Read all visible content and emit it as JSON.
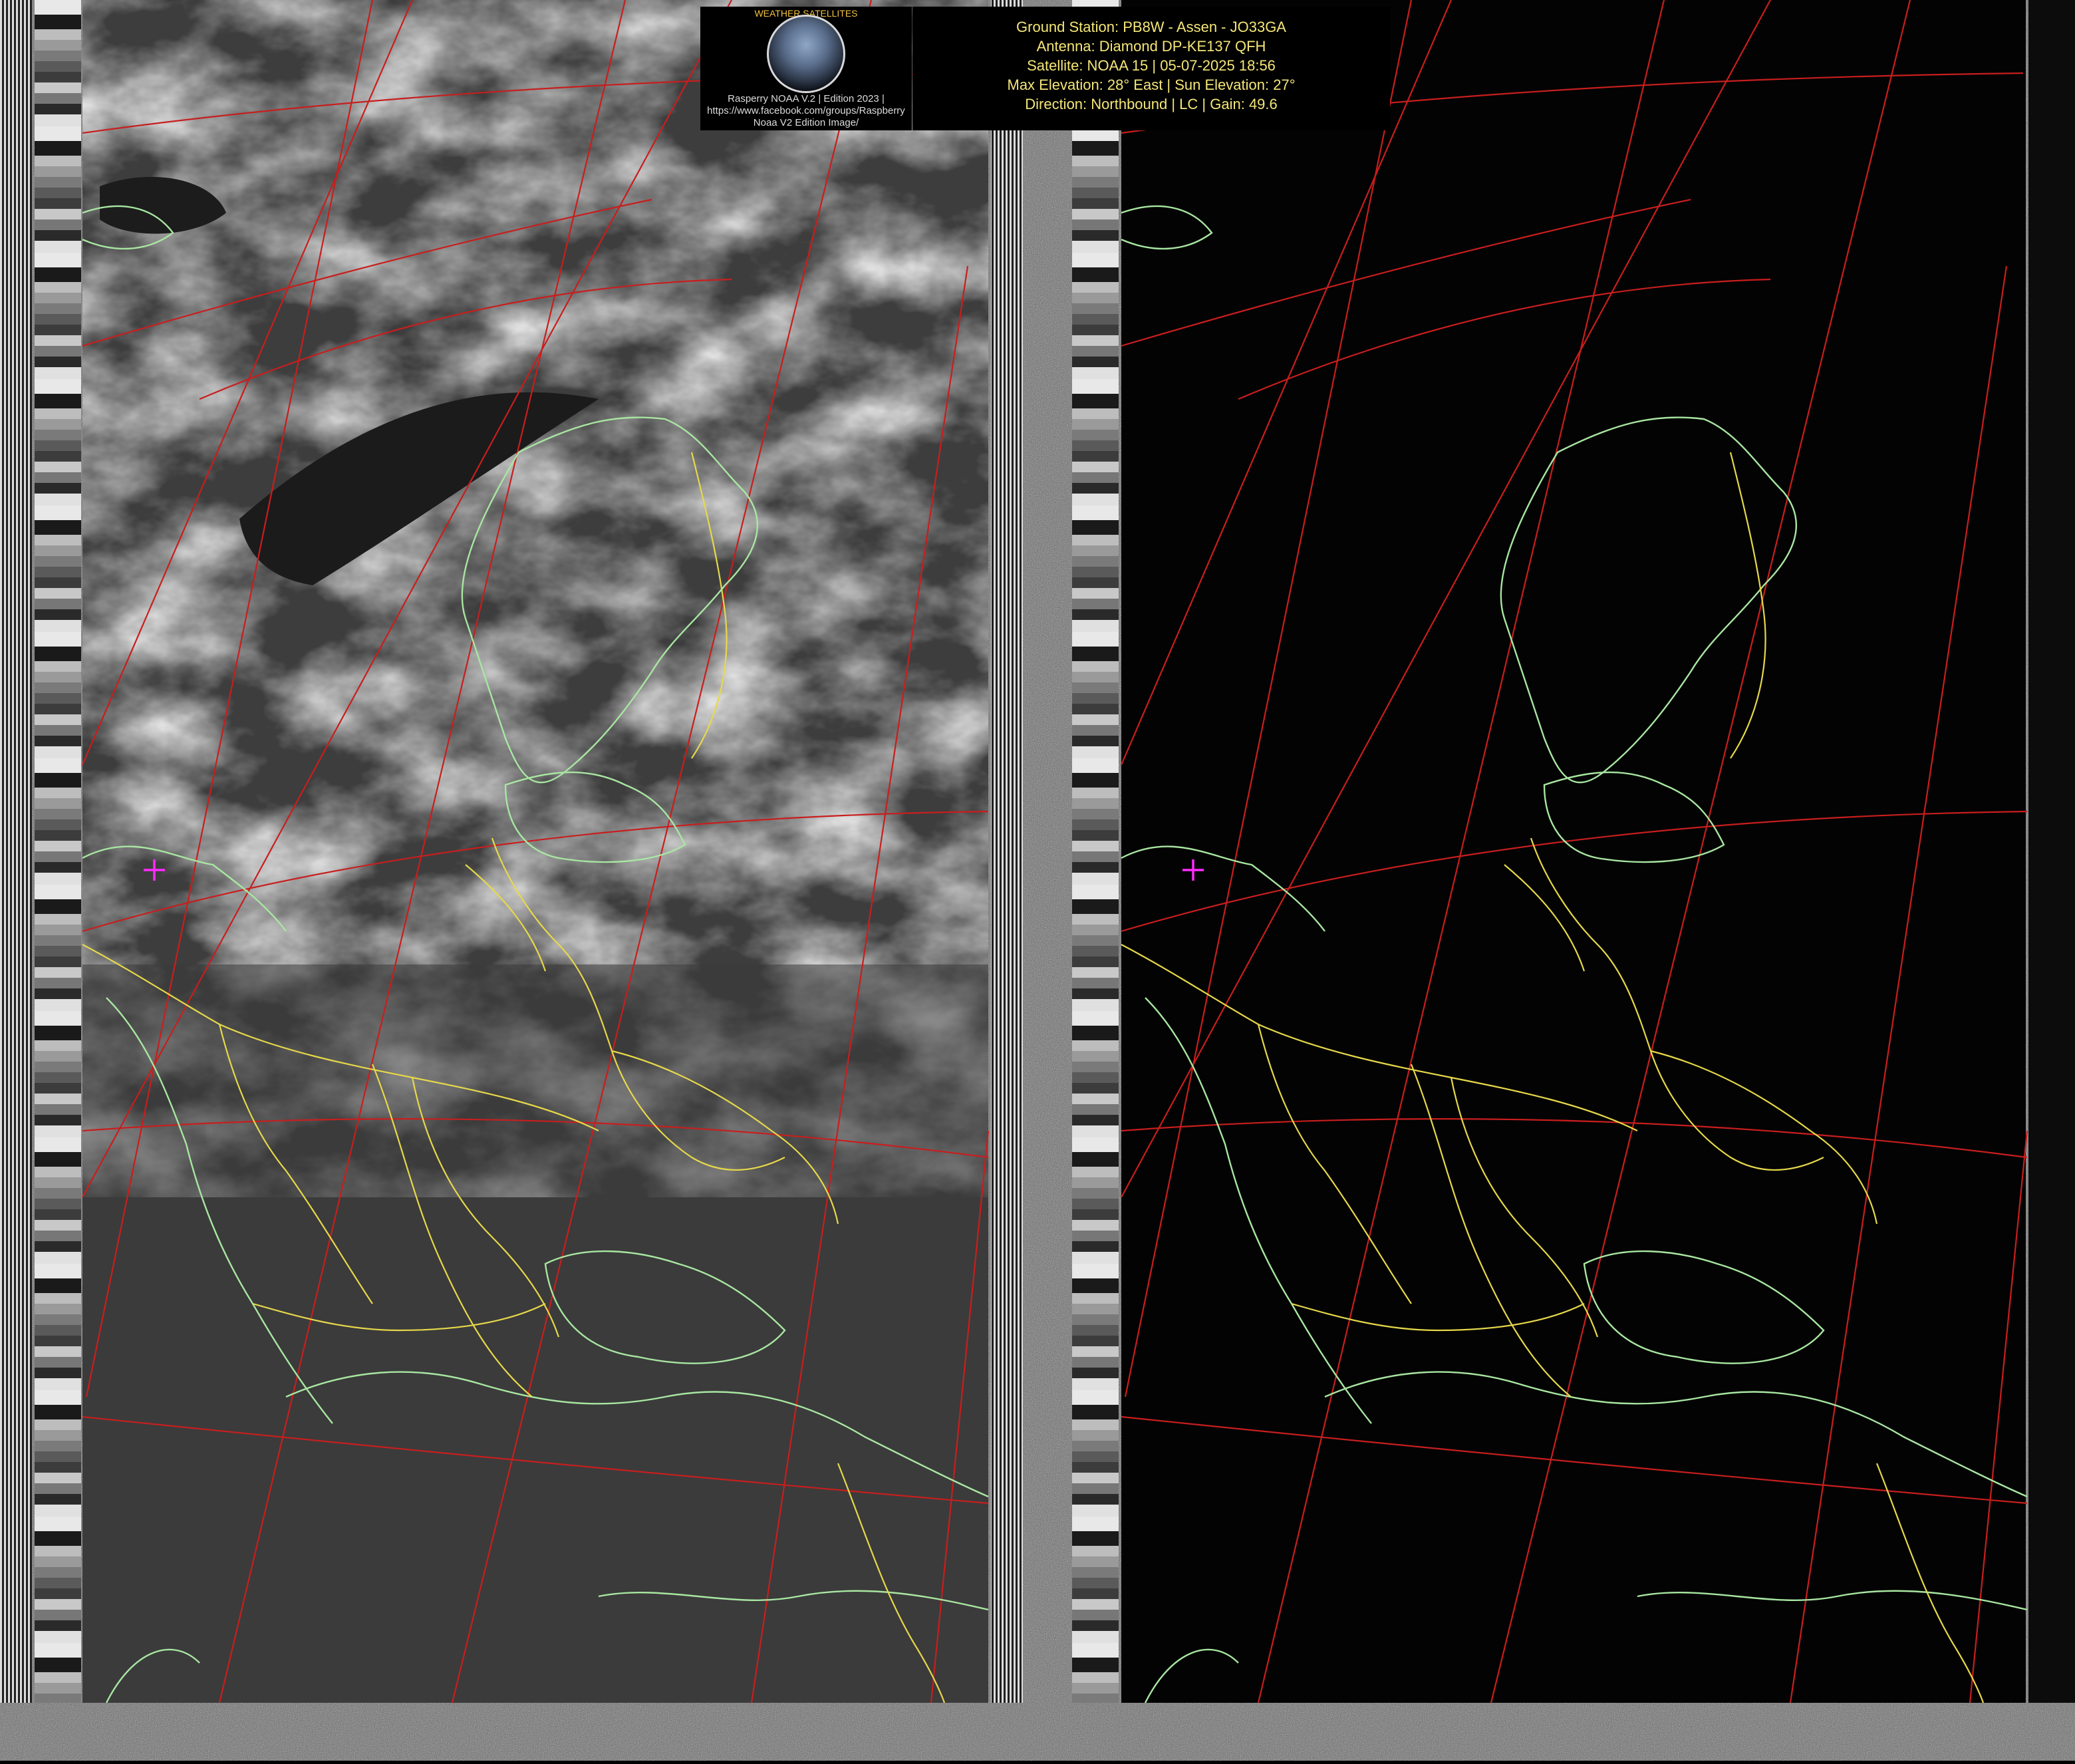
{
  "header": {
    "logo_text": "WEATHER SATELLITES",
    "credit_lines": [
      "Rasperry NOAA V.2 | Edition 2023 |",
      "https://www.facebook.com/groups/Raspberry",
      "Noaa V2 Edition Image/"
    ],
    "info_lines": [
      "Ground Station: PB8W - Assen - JO33GA",
      "Antenna: Diamond DP-KE137 QFH",
      "Satellite: NOAA 15 | 05-07-2025 18:56",
      "Max Elevation: 28° East | Sun Elevation: 27°",
      "Direction: Northbound | LC | Gain: 49.6"
    ]
  },
  "map": {
    "graticule_color": "#c81e1e",
    "coast_color": "#a8e6a1",
    "border_color": "#e6d84a",
    "marker_color": "#ff2bff",
    "marker_icon": "crosshair-marker-icon"
  }
}
